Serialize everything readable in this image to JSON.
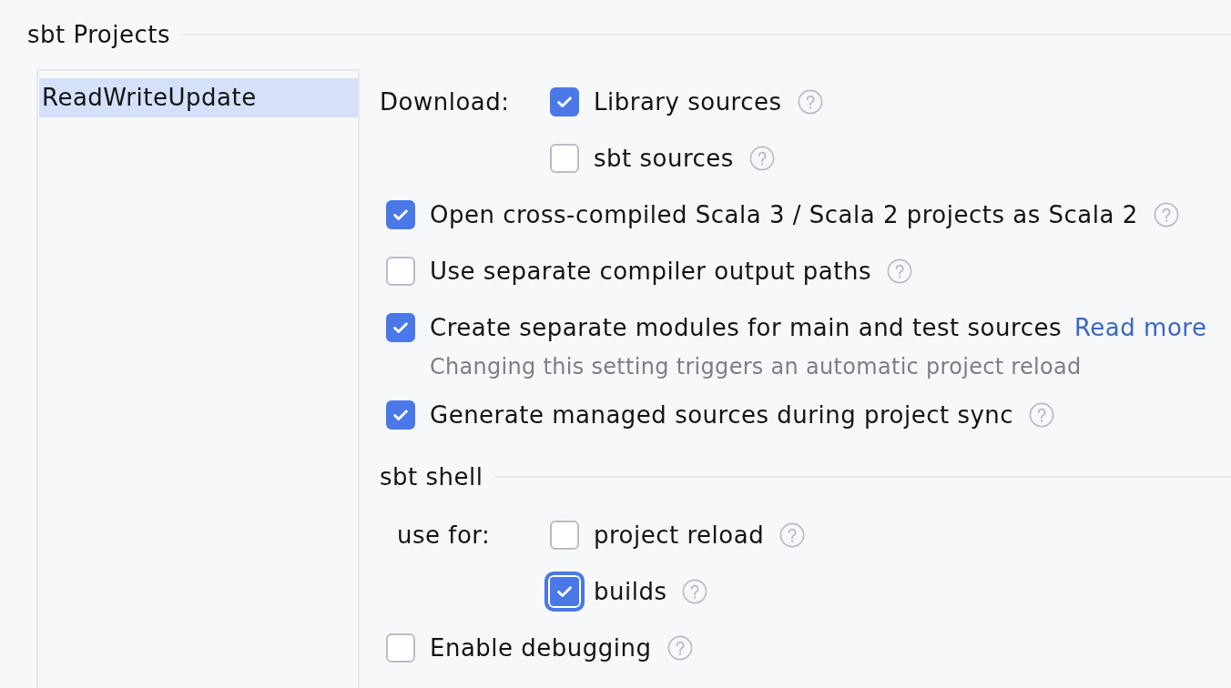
{
  "section_title": "sbt Projects",
  "projects": [
    {
      "name": "ReadWriteUpdate",
      "selected": true
    }
  ],
  "download": {
    "label": "Download:",
    "options": [
      {
        "label": "Library sources",
        "checked": true,
        "focused": false,
        "help": true
      },
      {
        "label": "sbt sources",
        "checked": false,
        "focused": false,
        "help": true
      }
    ]
  },
  "options": [
    {
      "label": "Open cross-compiled Scala 3 / Scala 2 projects as Scala 2",
      "checked": true,
      "focused": false,
      "help": true
    },
    {
      "label": "Use separate compiler output paths",
      "checked": false,
      "focused": false,
      "help": true
    },
    {
      "label": "Create separate modules for main and test sources",
      "checked": true,
      "focused": false,
      "help": false,
      "link": "Read more",
      "hint": "Changing this setting triggers an automatic project reload"
    },
    {
      "label": "Generate managed sources during project sync",
      "checked": true,
      "focused": false,
      "help": true
    }
  ],
  "sbt_shell": {
    "title": "sbt shell",
    "use_for": {
      "label": "use for:",
      "options": [
        {
          "label": "project reload",
          "checked": false,
          "focused": false,
          "help": true
        },
        {
          "label": "builds",
          "checked": true,
          "focused": true,
          "help": true
        }
      ]
    },
    "options": [
      {
        "label": "Enable debugging",
        "checked": false,
        "focused": false,
        "help": true
      }
    ]
  }
}
